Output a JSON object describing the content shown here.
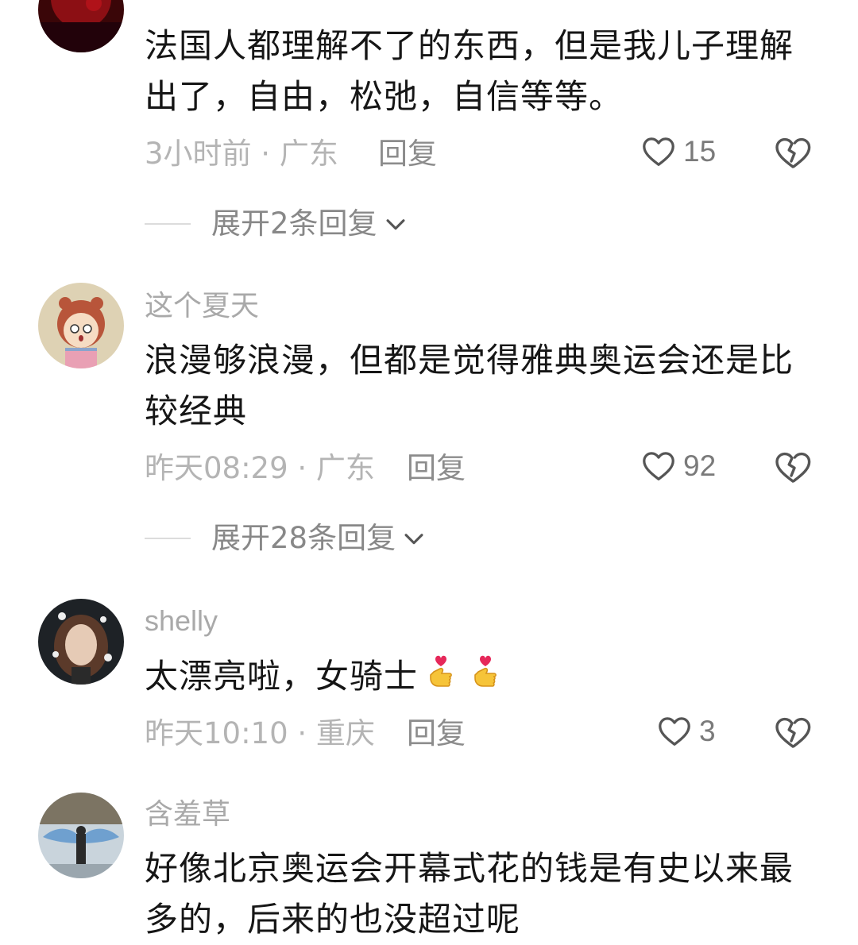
{
  "comments": [
    {
      "username": "",
      "text": "法国人都理解不了的东西，但是我儿子理解出了，自由，松弛，自信等等。",
      "meta": "3小时前 · 广东",
      "reply_label": "回复",
      "likes": "15",
      "expand_label": "展开2条回复"
    },
    {
      "username": "这个夏天",
      "text": "浪漫够浪漫，但都是觉得雅典奥运会还是比较经典",
      "meta": "昨天08:29 · 广东",
      "reply_label": "回复",
      "likes": "92",
      "expand_label": "展开28条回复"
    },
    {
      "username": "shelly",
      "text": "太漂亮啦，女骑士",
      "emojis": [
        "heart-hand-icon",
        "heart-hand-icon"
      ],
      "meta": "昨天10:10 · 重庆",
      "reply_label": "回复",
      "likes": "3"
    },
    {
      "username": "含羞草",
      "text": "好像北京奥运会开幕式花的钱是有史以来最多的，后来的也没超过呢"
    }
  ],
  "colors": {
    "meta_gray": "#b4b4b4",
    "text_dark": "#161616",
    "icon_gray": "#555555"
  },
  "icons": [
    "heart-outline-icon",
    "broken-heart-icon",
    "chevron-down-icon"
  ]
}
